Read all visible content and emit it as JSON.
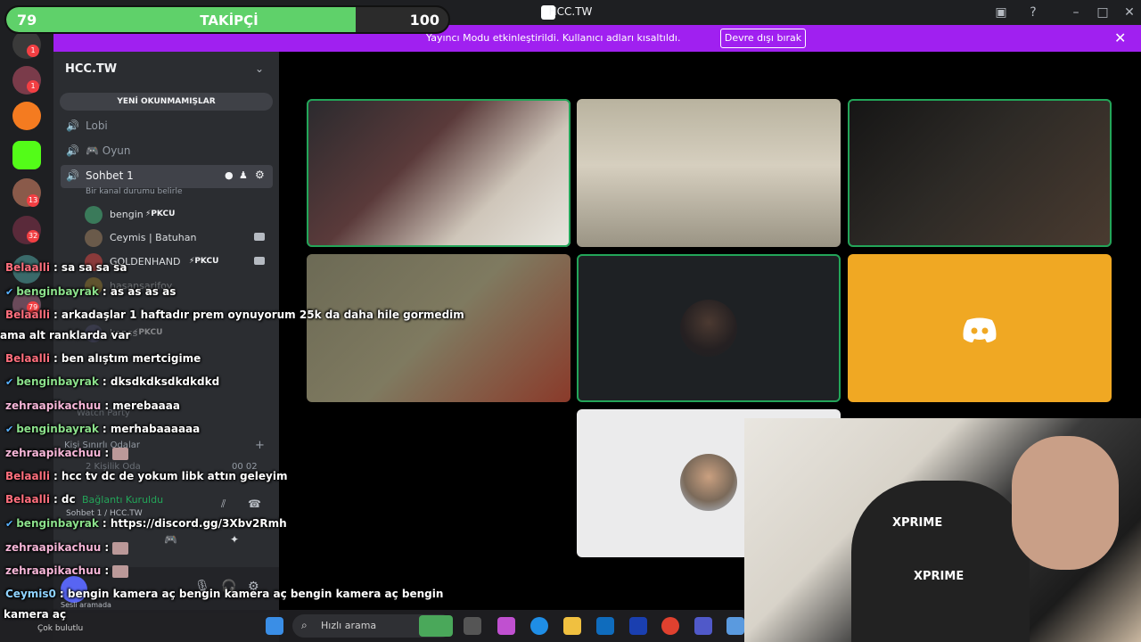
{
  "window": {
    "title": "HCC.TW"
  },
  "notice": {
    "text": "Yayıncı Modu etkinleştirildi. Kullanıcı adları kısaltıldı.",
    "button": "Devre dışı bırak"
  },
  "rail": {
    "badges": [
      "1",
      "1",
      "13",
      "32",
      "79"
    ]
  },
  "sidebar": {
    "guild_name": "HCC.TW",
    "unread_label": "YENİ OKUNMAMIŞLAR",
    "channels": [
      {
        "label": "Lobi",
        "icon": "speaker-icon"
      },
      {
        "label": "🎮 Oyun",
        "icon": "speaker-icon"
      },
      {
        "label": "Sohbet 1",
        "icon": "speaker-icon"
      }
    ],
    "channel_status": "Bir kanal durumu belirle",
    "members": [
      {
        "name": "bengin",
        "tag": "⚡PKCU"
      },
      {
        "name": "Ceymis | Batuhan",
        "tag": ""
      },
      {
        "name": "GOLDENHAND",
        "tag": "⚡PKCU"
      },
      {
        "name": "hasansarifoy",
        "tag": ""
      },
      {
        "name": "kanss",
        "tag": "⚡PKCU"
      }
    ],
    "sections": {
      "watch_party": "Watch Party",
      "limited_rooms": "Kişi Sınırlı Odalar",
      "two_person_room": "2 Kişilik Oda",
      "two_person_counts": "00  02"
    },
    "voice": {
      "status": "Bağlantı Kuruldu",
      "channel": "Sohbet 1 / HCC.TW"
    },
    "user": {
      "status": "Sesli aramada"
    }
  },
  "follower_goal": {
    "label": "TAKİPÇİ",
    "current": "79",
    "target": "100",
    "progress": 0.79
  },
  "chat": [
    {
      "user": "Belaalli",
      "color": "red",
      "text": "sa sa sa sa"
    },
    {
      "user": "benginbayrak",
      "color": "green",
      "text": "as as as as",
      "check": true
    },
    {
      "user": "Belaalli",
      "color": "red",
      "text": "arkadaşlar 1 haftadır prem oynuyorum 25k da daha hile gormedim"
    },
    {
      "user": "",
      "color": "red",
      "text": "ama alt ranklarda var"
    },
    {
      "user": "Belaalli",
      "color": "red",
      "text": "ben alıştım mertcigime"
    },
    {
      "user": "benginbayrak",
      "color": "green",
      "text": "dksdkdksdkdkdkd",
      "check": true
    },
    {
      "user": "zehraapikachuu",
      "color": "pink",
      "text": "merebaaaa"
    },
    {
      "user": "benginbayrak",
      "color": "green",
      "text": "merhabaaaaaa",
      "check": true
    },
    {
      "user": "zehraapikachuu",
      "color": "pink",
      "text": ""
    },
    {
      "user": "Belaalli",
      "color": "red",
      "text": "hcc tv dc de yokum libk attın geleyim"
    },
    {
      "user": "Belaalli",
      "color": "red",
      "text": "dc"
    },
    {
      "user": "benginbayrak",
      "color": "green",
      "text": "https://discord.gg/3Xbv2Rmh",
      "check": true
    },
    {
      "user": "zehraapikachuu",
      "color": "pink",
      "text": ""
    },
    {
      "user": "zehraapikachuu",
      "color": "pink",
      "text": ""
    },
    {
      "user": "Ceymis0",
      "color": "cyan",
      "text": "bengin kamera aç bengin kamera aç bengin kamera aç bengin"
    },
    {
      "user": "",
      "color": "cyan",
      "text": "kamera aç"
    }
  ],
  "webcam": {
    "brand": "XPRIME"
  },
  "taskbar": {
    "search_placeholder": "Hızlı arama",
    "weather": "Çok bulutlu"
  },
  "colors": {
    "accent": "#5865f2",
    "speaking": "#23a559",
    "notice": "#a020f0",
    "discord_tile": "#f0a823"
  }
}
